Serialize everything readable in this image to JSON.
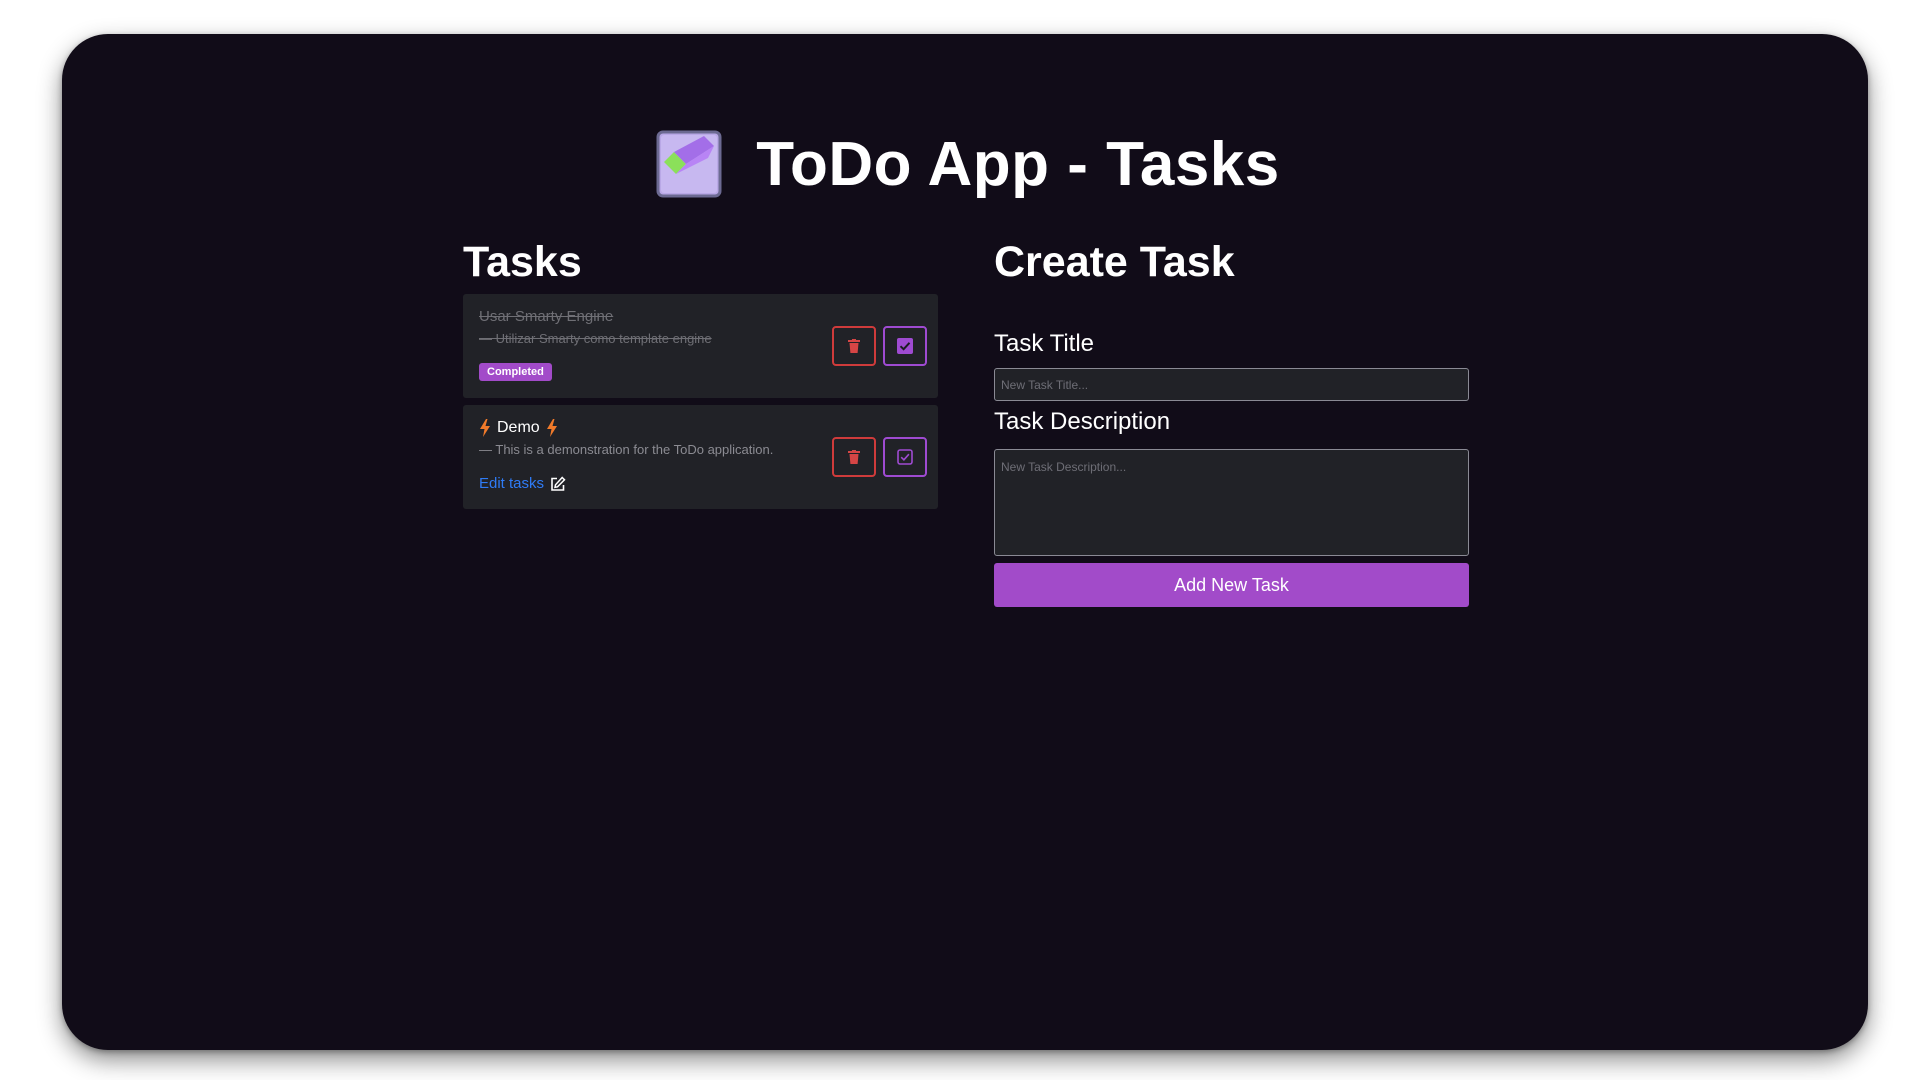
{
  "app": {
    "title": "ToDo App - Tasks",
    "logo_icon": "pencil-check-logo-icon"
  },
  "tasks_section": {
    "heading": "Tasks",
    "items": [
      {
        "title": "Usar Smarty Engine",
        "description": "— Utilizar Smarty como template engine",
        "completed": true,
        "badge": "Completed",
        "checkbox_checked": true
      },
      {
        "title": "Demo",
        "description": "— This is a demonstration for the ToDo application.",
        "completed": false,
        "edit_label": "Edit tasks",
        "checkbox_checked": false,
        "title_icon": "lightning-bolt-icon"
      }
    ]
  },
  "create_section": {
    "heading": "Create Task",
    "title_label": "Task Title",
    "title_placeholder": "New Task Title...",
    "title_value": "",
    "description_label": "Task Description",
    "description_placeholder": "New Task Description...",
    "description_value": "",
    "submit_label": "Add New Task"
  },
  "colors": {
    "background": "#110c18",
    "card": "#212227",
    "accent_purple": "#a24bc9",
    "delete_red": "#cf3b3b",
    "link_blue": "#2f7bf5",
    "bolt_orange": "#f07a2a"
  }
}
